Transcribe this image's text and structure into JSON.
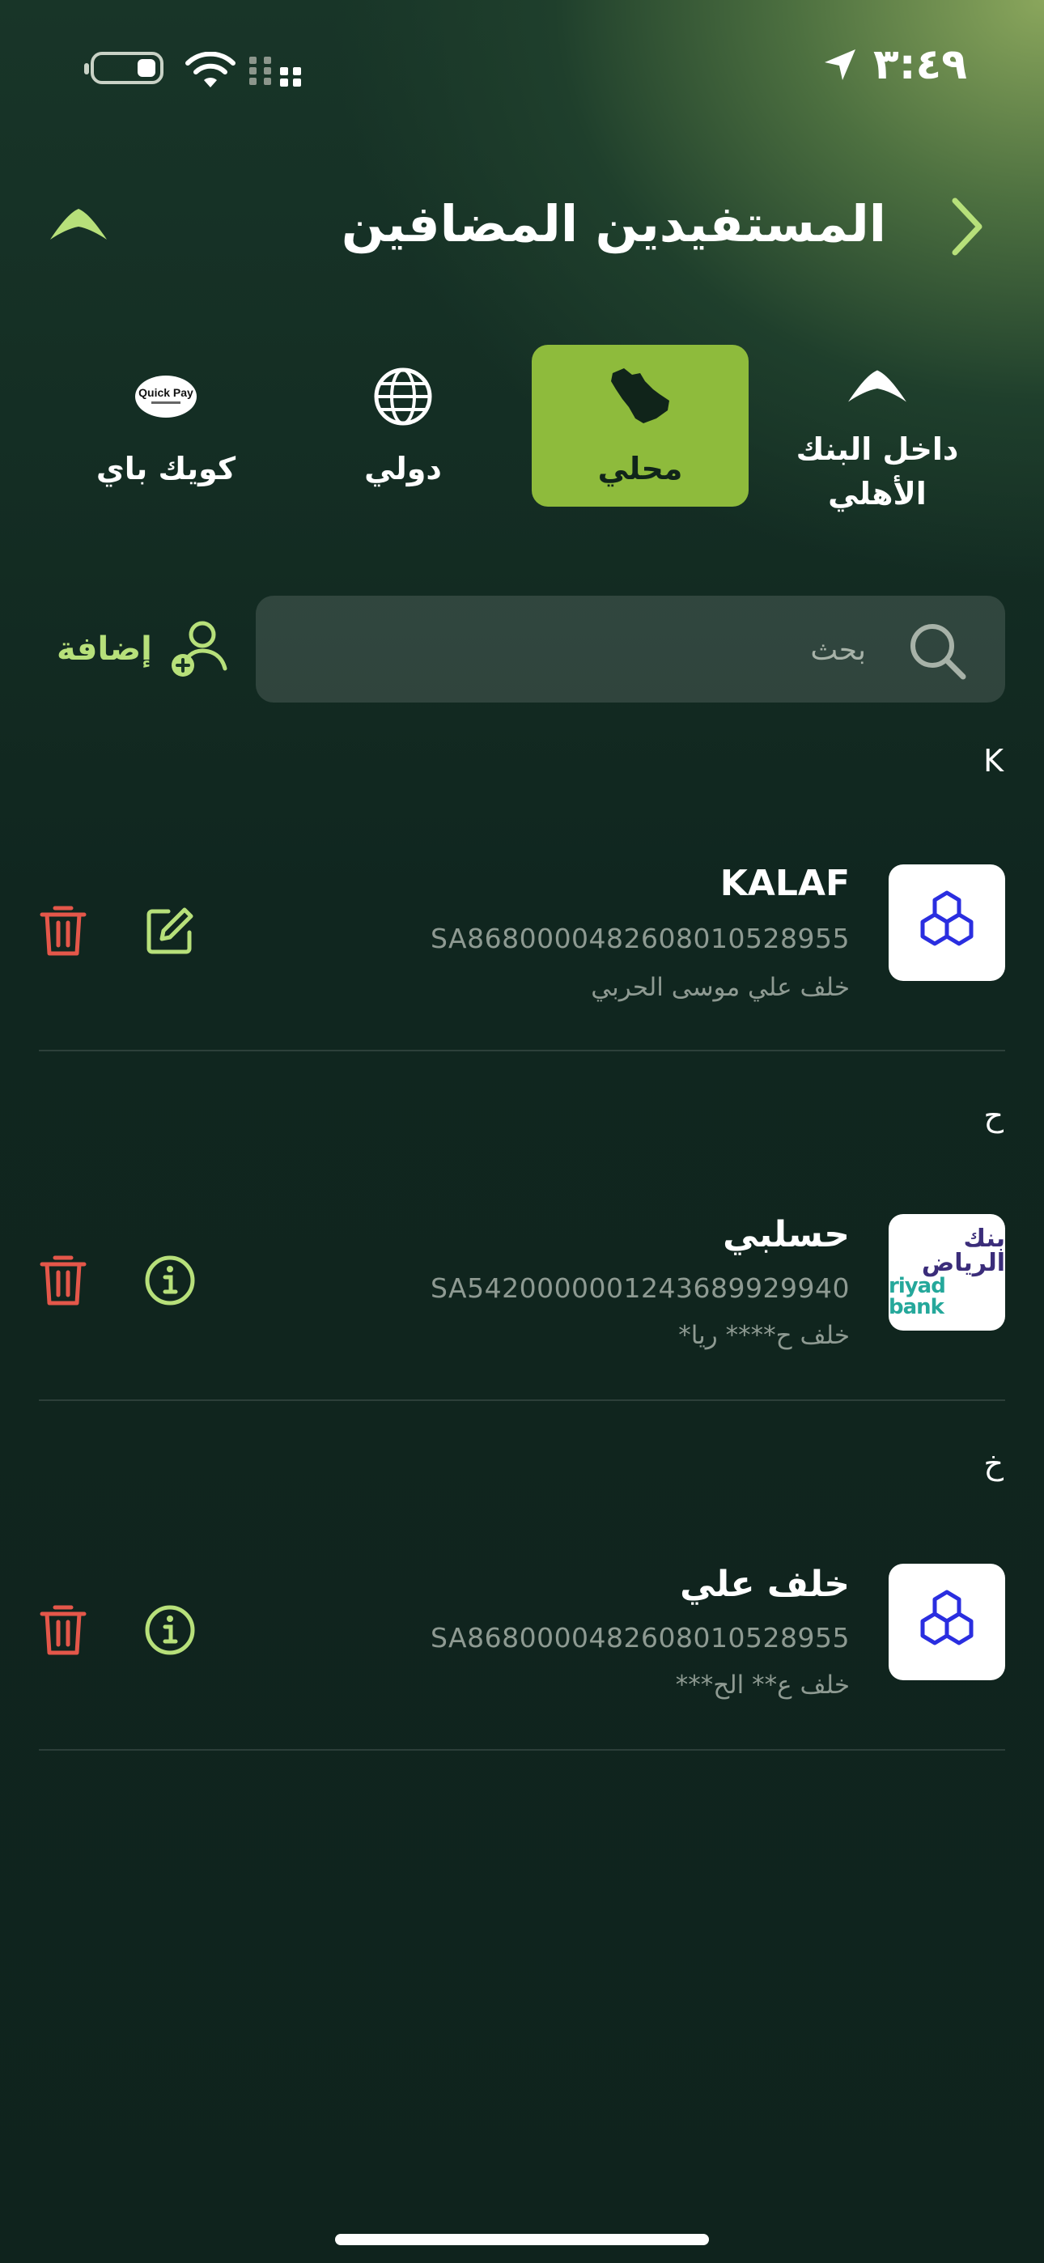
{
  "status_bar": {
    "time": "٣:٤٩"
  },
  "header": {
    "title": "المستفيدين المضافين"
  },
  "tabs": [
    {
      "label": "داخل البنك\nالأهلي",
      "icon": "snb-logo-icon"
    },
    {
      "label": "محلي",
      "icon": "saudi-map-icon",
      "active": true
    },
    {
      "label": "دولي",
      "icon": "globe-icon"
    },
    {
      "label": "كويك باي",
      "icon": "quick-pay-icon",
      "logo_text": "Quick Pay"
    }
  ],
  "search": {
    "placeholder": "بحث"
  },
  "add_button": {
    "label": "إضافة"
  },
  "sections": [
    {
      "letter": "K",
      "beneficiaries": [
        {
          "name": "KALAF",
          "iban": "SA8680000482608010528955",
          "holder": "خلف علي موسى الحربي",
          "bank": "alrajhi",
          "action": "edit"
        }
      ]
    },
    {
      "letter": "ح",
      "beneficiaries": [
        {
          "name": "حسلبي",
          "iban": "SA5420000001243689929940",
          "holder": "خلف ح**** ريا*",
          "bank": "riyad",
          "bank_logo_ar": "بنك الرياض",
          "bank_logo_en": "riyad bank",
          "action": "info"
        }
      ]
    },
    {
      "letter": "خ",
      "beneficiaries": [
        {
          "name": "خلف علي",
          "iban": "SA8680000482608010528955",
          "holder": "خلف ع** الح***",
          "bank": "alrajhi",
          "action": "info"
        }
      ]
    }
  ],
  "colors": {
    "accent": "#8ebb3c",
    "accent_text": "#b7e07a",
    "delete": "#e4574a",
    "bank_icon": "#2a2ee0"
  }
}
